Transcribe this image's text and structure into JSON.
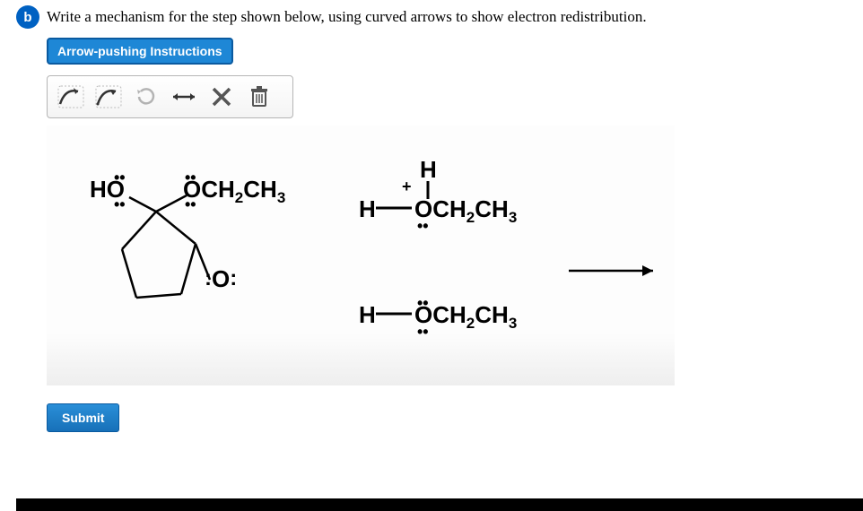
{
  "part_label": "b",
  "question": "Write a mechanism for the step shown below, using curved arrows to show electron redistribution.",
  "instructions_button": "Arrow-pushing Instructions",
  "toolbar": {
    "tools": [
      "single-arrow",
      "double-arrow",
      "redo",
      "resonance",
      "delete",
      "trash"
    ]
  },
  "chem": {
    "left_ho": "HO",
    "left_och2ch3": "OCH",
    "left_och2ch3_part2": "CH",
    "left_o": "O",
    "right_h": "H",
    "right_h2": "H",
    "right_plus": "+",
    "right_och2ch3_a": "OCH",
    "right_och2ch3_a2": "CH",
    "right_och2ch3_b": "OCH",
    "right_och2ch3_b2": "CH",
    "sub2": "2",
    "sub3": "3"
  },
  "submit_label": "Submit"
}
